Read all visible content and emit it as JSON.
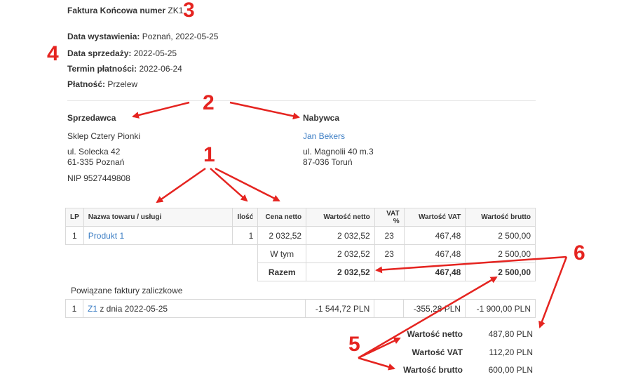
{
  "invoice": {
    "title_label": "Faktura Końcowa numer",
    "number": "ZK1"
  },
  "details": [
    {
      "label": "Data wystawienia:",
      "value": "Poznań, 2022-05-25"
    },
    {
      "label": "Data sprzedaży:",
      "value": "2022-05-25"
    },
    {
      "label": "Termin płatności:",
      "value": "2022-06-24"
    },
    {
      "label": "Płatność:",
      "value": "Przelew"
    }
  ],
  "seller": {
    "heading": "Sprzedawca",
    "name": "Sklep Cztery Pionki",
    "street": "ul. Solecka 42",
    "city": "61-335 Poznań",
    "nip": "NIP 9527449808"
  },
  "buyer": {
    "heading": "Nabywca",
    "name": "Jan Bekers",
    "street": "ul. Magnolii 40 m.3",
    "city": "87-036 Toruń"
  },
  "items_table": {
    "headers": [
      "LP",
      "Nazwa towaru / usługi",
      "Ilość",
      "Cena netto",
      "Wartość netto",
      "VAT %",
      "Wartość VAT",
      "Wartość brutto"
    ],
    "rows": [
      [
        "1",
        "Produkt 1",
        "1",
        "2 032,52",
        "2 032,52",
        "23",
        "467,48",
        "2 500,00"
      ]
    ],
    "in_which": {
      "label": "W tym",
      "net": "2 032,52",
      "vat_rate": "23",
      "vat": "467,48",
      "gross": "2 500,00"
    },
    "total": {
      "label": "Razem",
      "net": "2 032,52",
      "vat": "467,48",
      "gross": "2 500,00"
    }
  },
  "advance": {
    "heading": "Powiązane faktury zaliczkowe",
    "rows": [
      {
        "lp": "1",
        "invoice": "Z1",
        "date_text": "z dnia 2022-05-25",
        "net": "-1 544,72 PLN",
        "vat": "-355,28 PLN",
        "gross": "-1 900,00 PLN"
      }
    ]
  },
  "summary": [
    {
      "label": "Wartość netto",
      "value": "487,80 PLN"
    },
    {
      "label": "Wartość VAT",
      "value": "112,20 PLN"
    },
    {
      "label": "Wartość brutto",
      "value": "600,00 PLN"
    }
  ],
  "annotations": [
    "1",
    "2",
    "3",
    "4",
    "5",
    "6"
  ],
  "colors": {
    "annotation": "#e52420",
    "link": "#3b7dc4"
  }
}
